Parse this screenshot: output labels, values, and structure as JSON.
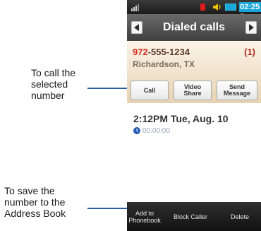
{
  "callouts": {
    "call": {
      "line1": "To call the",
      "line2": "selected",
      "line3": "number"
    },
    "save": {
      "line1": "To save the",
      "line2": "number to the",
      "line3": "Address Book"
    }
  },
  "status_bar": {
    "time": "02:25 P",
    "signal_icon": "signal-icon",
    "speaker_icon": "speaker-icon",
    "battery_icon": "battery-icon"
  },
  "titlebar": {
    "title": "Dialed calls"
  },
  "contact": {
    "number_prefix": "972",
    "number_rest": "-555-1234",
    "count": "(1)",
    "location": "Richardson, TX"
  },
  "actions": {
    "call": "Call",
    "video_line1": "Video",
    "video_line2": "Share",
    "send_line1": "Send",
    "send_line2": "Message"
  },
  "call_detail": {
    "datetime": "2:12PM Tue, Aug. 10",
    "duration": "00:00:00"
  },
  "bottom_bar": {
    "add_line1": "Add to",
    "add_line2": "Phonebook",
    "block": "Block Caller",
    "delete": "Delete"
  },
  "colors": {
    "callout_line": "#2a5fa8",
    "accent_time": "#1aa6d9",
    "number_highlight": "#d62b1e"
  }
}
